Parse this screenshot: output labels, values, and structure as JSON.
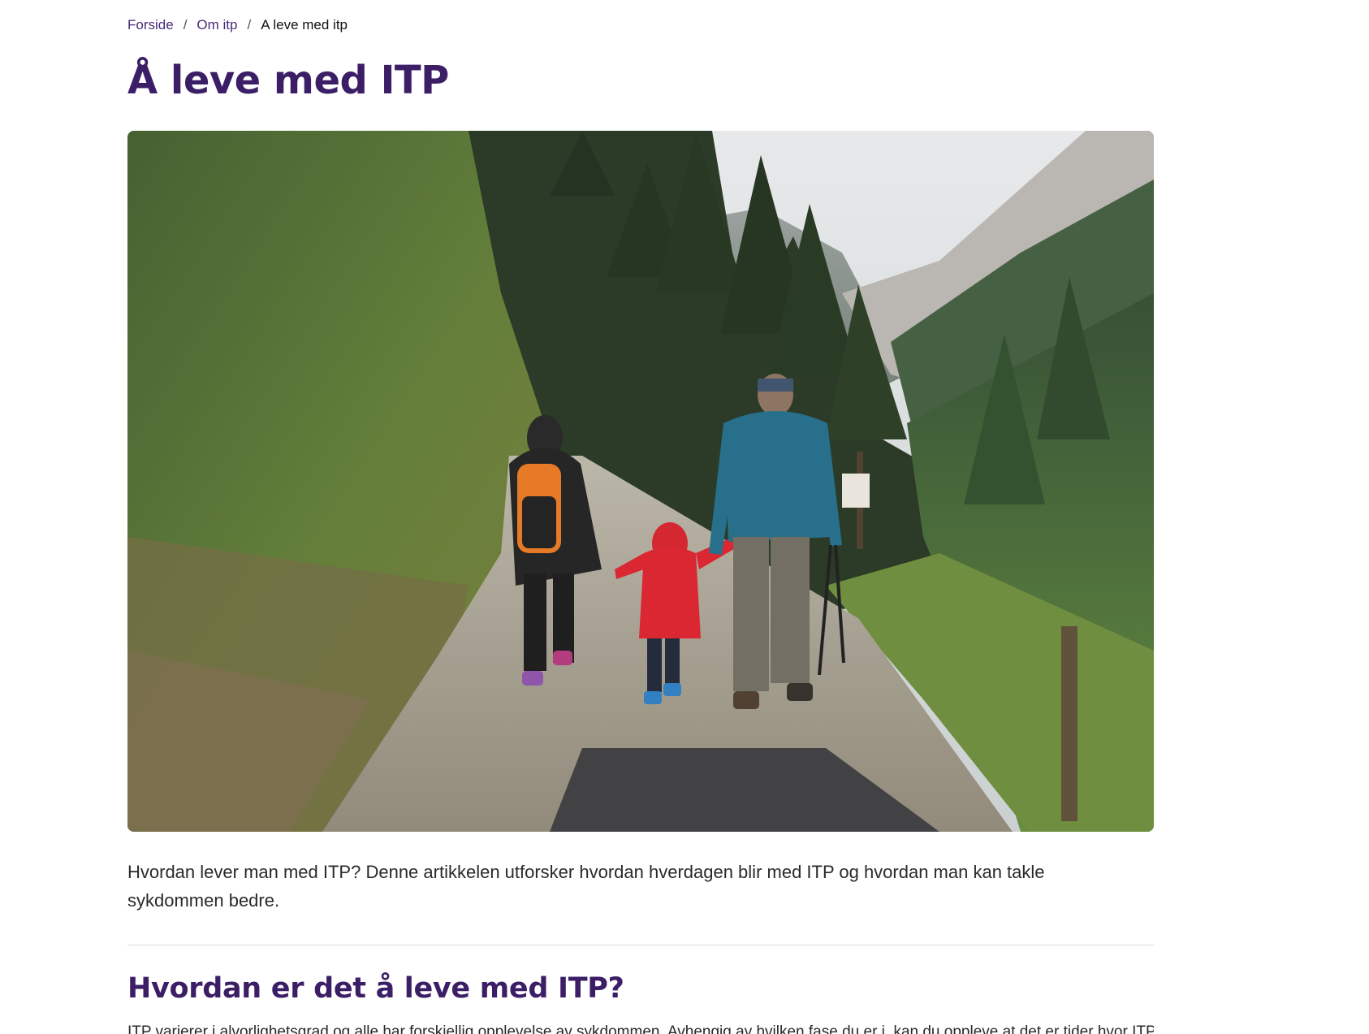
{
  "breadcrumb": {
    "items": [
      {
        "label": "Forside"
      },
      {
        "label": "Om itp"
      }
    ],
    "separator": "/",
    "current": "A leve med itp"
  },
  "article": {
    "title": "Å leve med ITP",
    "hero_image": {
      "alt": "hero-photo"
    },
    "lead": "Hvordan lever man med ITP? Denne artikkelen utforsker hvordan hverdagen blir med ITP og hvordan man kan takle sykdommen bedre.",
    "section_heading": "Hvordan er det å leve med ITP?",
    "section_text": "ITP varierer i alvorlighetsgrad og alle har forskjellig opplevelse av sykdommen. Avhengig av hvilken fase du er i, kan du oppleve at det er tider hvor ITP"
  },
  "colors": {
    "brand_purple": "#3b1e66",
    "link_purple": "#4a2a7a",
    "divider": "#d9d9d9"
  }
}
